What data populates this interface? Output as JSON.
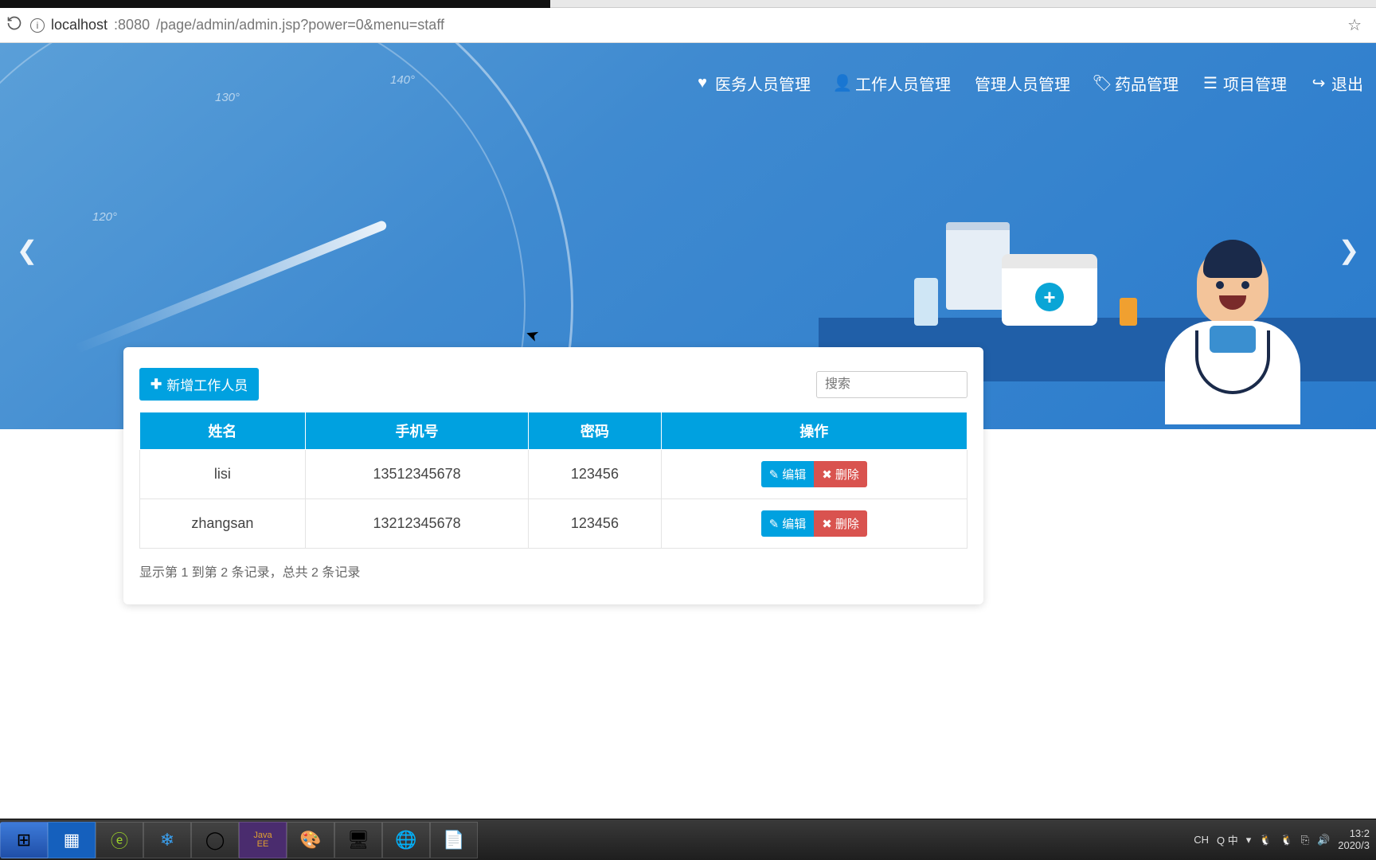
{
  "browser": {
    "url_host": "localhost",
    "url_port": ":8080",
    "url_path": "/page/admin/admin.jsp?power=0&menu=staff"
  },
  "nav": {
    "items": [
      {
        "icon": "heart-icon",
        "glyph": "♥",
        "label": "医务人员管理"
      },
      {
        "icon": "user-icon",
        "glyph": "👤",
        "label": "工作人员管理"
      },
      {
        "icon": "",
        "glyph": "",
        "label": "管理人员管理"
      },
      {
        "icon": "tag-icon",
        "glyph": "🏷",
        "label": "药品管理"
      },
      {
        "icon": "list-icon",
        "glyph": "☰",
        "label": "项目管理"
      },
      {
        "icon": "exit-icon",
        "glyph": "↪",
        "label": "退出"
      }
    ]
  },
  "gauge_labels": {
    "l120": "120°",
    "l130": "130°",
    "l140": "140°"
  },
  "toolbar": {
    "add_label": "新增工作人员",
    "search_placeholder": "搜索"
  },
  "table": {
    "headers": {
      "name": "姓名",
      "phone": "手机号",
      "password": "密码",
      "ops": "操作"
    },
    "rows": [
      {
        "name": "lisi",
        "phone": "13512345678",
        "password": "123456"
      },
      {
        "name": "zhangsan",
        "phone": "13212345678",
        "password": "123456"
      }
    ],
    "edit_label": "编辑",
    "delete_label": "删除"
  },
  "pager_text": "显示第 1 到第 2 条记录，总共 2 条记录",
  "taskbar": {
    "ime": "CH",
    "ime2": "Q 中",
    "time": "13:2",
    "date": "2020/3"
  }
}
